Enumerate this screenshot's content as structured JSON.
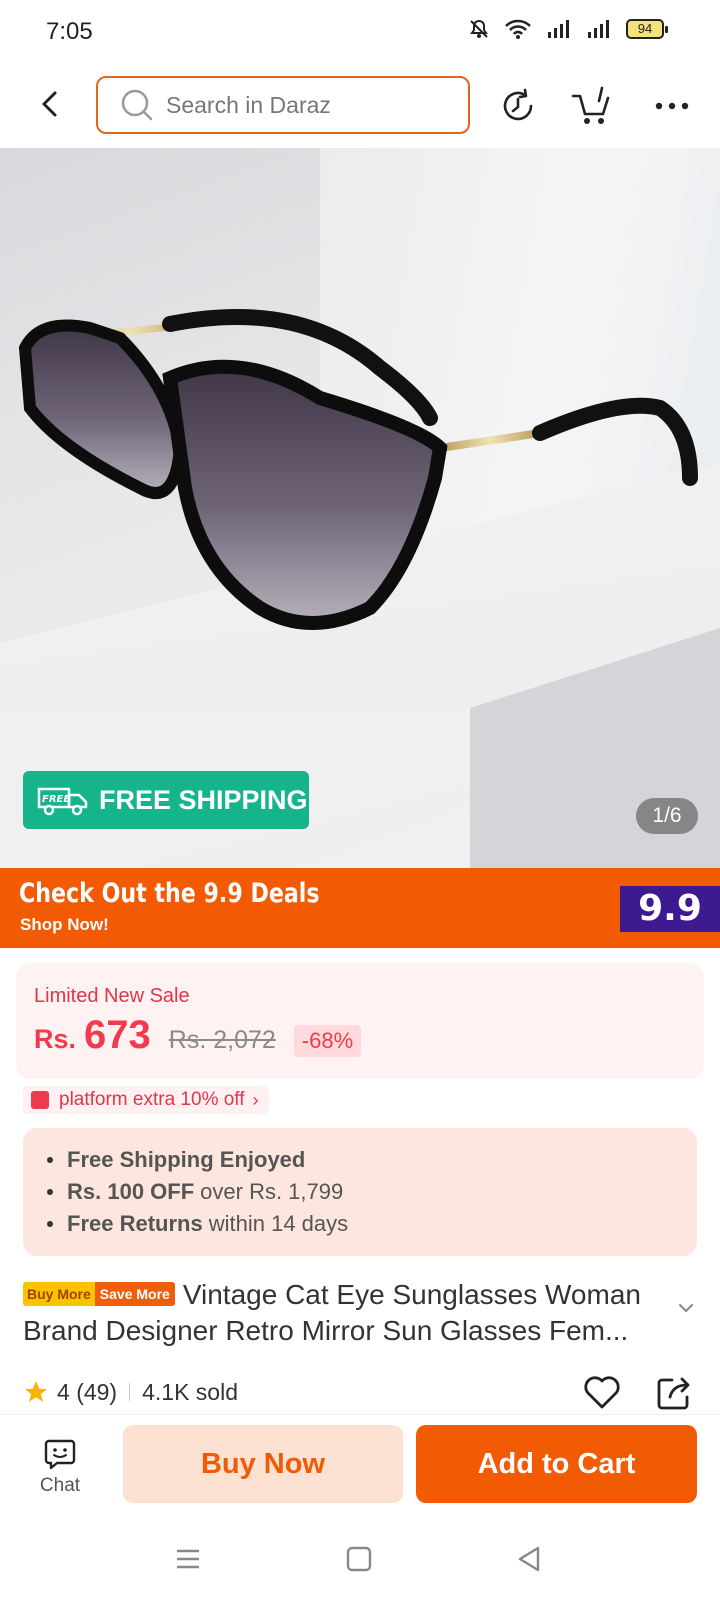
{
  "status_bar": {
    "time": "7:05",
    "battery": "94"
  },
  "header": {
    "search_placeholder": "Search in Daraz"
  },
  "gallery": {
    "free_shipping_label": "FREE SHIPPING",
    "free_shipping_truck_text": "FREE",
    "counter": "1/6"
  },
  "promo": {
    "title": "Check Out the 9.9 Deals",
    "subtitle": "Shop Now!",
    "badge": "9.9"
  },
  "price": {
    "sale_label": "Limited New Sale",
    "currency": "Rs.",
    "current": "673",
    "original": "Rs. 2,072",
    "discount": "-68%"
  },
  "voucher": {
    "label": "platform extra 10% off"
  },
  "benefits": [
    {
      "bold": "Free Shipping Enjoyed",
      "rest": ""
    },
    {
      "bold": "Rs. 100 OFF",
      "rest": "over Rs. 1,799"
    },
    {
      "bold": "Free Returns",
      "rest": "within 14 days"
    }
  ],
  "product": {
    "tag_buy": "Buy More",
    "tag_save": "Save More",
    "title_line1": "Vintage Cat Eye Sunglasses Woman",
    "title_line2": "Brand Designer Retro Mirror Sun Glasses Fem..."
  },
  "rating": {
    "score": "4",
    "count": "(49)",
    "sold": "4.1K sold"
  },
  "actions": {
    "chat": "Chat",
    "buy_now": "Buy Now",
    "add_to_cart": "Add to Cart"
  },
  "colors": {
    "brand_orange": "#f25a04",
    "free_shipping_green": "#16b48a",
    "price_red": "#f23a4d"
  }
}
